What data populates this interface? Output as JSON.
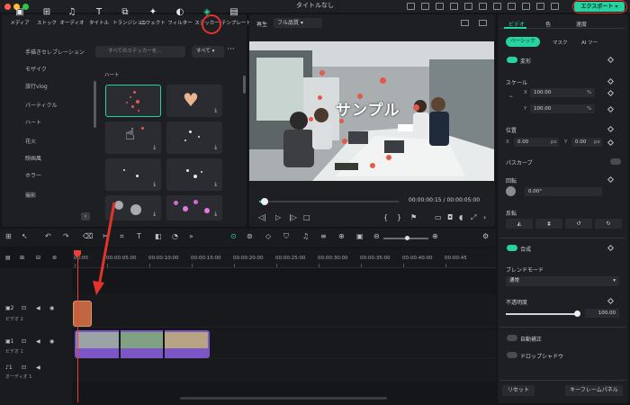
{
  "app": {
    "title": "タイトルなし",
    "export_label": "エクスポート"
  },
  "media_toolbar": {
    "tools": [
      {
        "label": "メディア",
        "icon": "media-icon"
      },
      {
        "label": "ストック",
        "icon": "stock-icon"
      },
      {
        "label": "オーディオ",
        "icon": "audio-icon"
      },
      {
        "label": "タイトル",
        "icon": "title-icon"
      },
      {
        "label": "トランジション",
        "icon": "transition-icon"
      },
      {
        "label": "エフェクト",
        "icon": "effects-icon"
      },
      {
        "label": "フィルター",
        "icon": "filter-icon"
      },
      {
        "label": "ステッカー",
        "icon": "sticker-icon"
      },
      {
        "label": "テンプレート",
        "icon": "template-icon"
      }
    ]
  },
  "sidebar": {
    "items": [
      "手描きセレブレーション",
      "モザイク",
      "旅行vlog",
      "パーティクル",
      "ハート",
      "花火",
      "映画風",
      "ホラー",
      "撮影"
    ]
  },
  "search": {
    "placeholder": "すべてのステッカーを...",
    "filter": "すべて"
  },
  "sticker_section": {
    "header": "ハート"
  },
  "player": {
    "label": "再生",
    "quality": "フル品質",
    "current_time": "00:00:00:15",
    "separator": "/",
    "total_time": "00:00:05:00",
    "overlay_text": "サンプル"
  },
  "properties": {
    "tabs": [
      "ビデオ",
      "色",
      "速度"
    ],
    "subtabs": [
      "ベーシック",
      "マスク",
      "AI ツー"
    ],
    "transform": "変形",
    "scale": "スケール",
    "scale_x": "100.00",
    "scale_y": "100.00",
    "percent": "%",
    "position": "位置",
    "pos_x": "0.00",
    "pos_y": "0.00",
    "px": "px",
    "path_curve": "パスカーブ",
    "rotate": "回転",
    "rotate_val": "0.00°",
    "flip": "反転",
    "composite": "合成",
    "blend_mode": "ブレンドモード",
    "blend_value": "通常",
    "opacity": "不透明度",
    "opacity_val": "100.00",
    "opacity_level": 1.0,
    "auto_correct": "自動補正",
    "drop_shadow": "ドロップシャドウ",
    "reset": "リセット",
    "keyframe_panel": "キーフレームパネル",
    "x": "X",
    "y": "Y"
  },
  "timeline": {
    "ruler": [
      "00:00",
      "00:00:05:00",
      "00:00:10:00",
      "00:00:15:00",
      "00:00:20:00",
      "00:00:25:00",
      "00:00:30:00",
      "00:00:35:00",
      "00:00:40:00",
      "00:00:45"
    ],
    "tracks": [
      {
        "label": "ビデオ 2",
        "number": "2"
      },
      {
        "label": "ビデオ 1",
        "number": "1"
      },
      {
        "label": "オーディオ 1",
        "number": "1"
      }
    ]
  },
  "colors": {
    "accent": "#26d3a0",
    "annotation": "#e5322b",
    "video_clip": "#7c55c6",
    "sticker_clip": "#c1673f"
  }
}
